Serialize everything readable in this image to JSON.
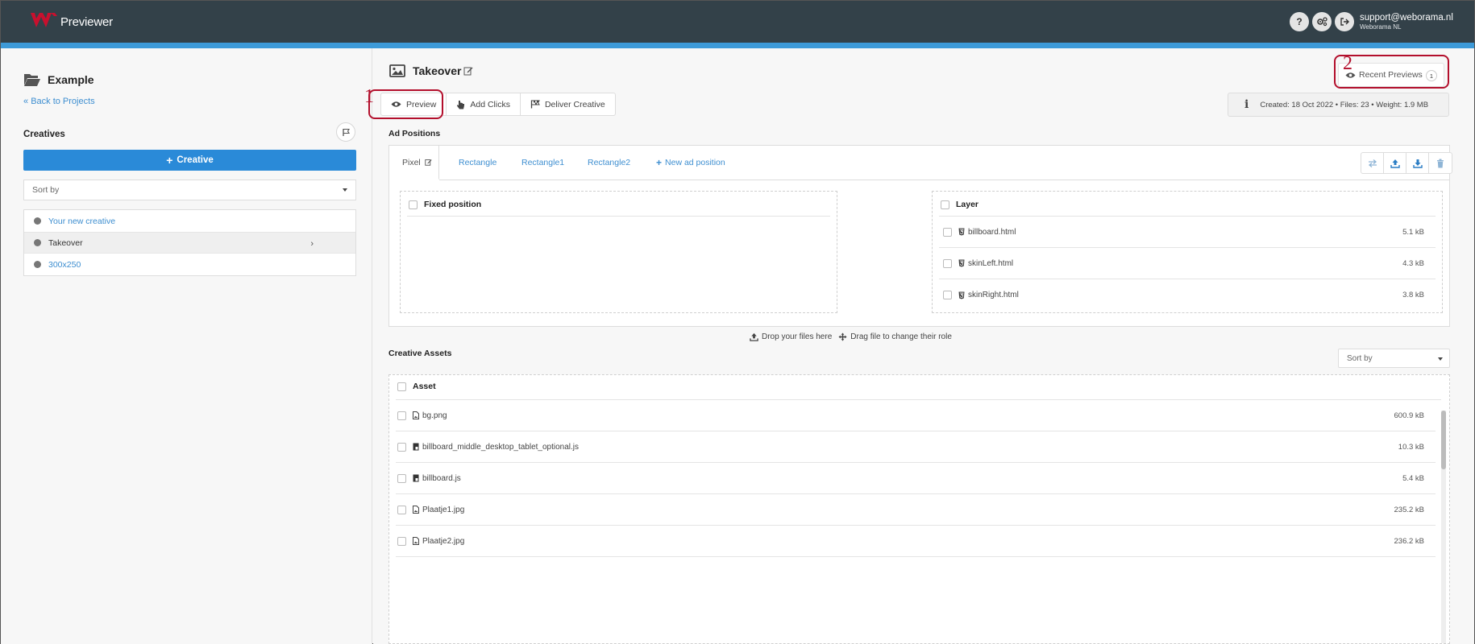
{
  "header": {
    "brand": "Previewer",
    "user_email": "support@weborama.nl",
    "user_org": "Weborama NL",
    "help_icon": "?"
  },
  "sidebar": {
    "project_title": "Example",
    "back_link": "Back to Projects",
    "creatives_label": "Creatives",
    "add_creative_label": "Creative",
    "sort_placeholder": "Sort by",
    "creatives": [
      {
        "name": "Your new creative",
        "active": false
      },
      {
        "name": "Takeover",
        "active": true
      },
      {
        "name": "300x250",
        "active": false
      }
    ]
  },
  "main": {
    "title": "Takeover",
    "recent_previews_label": "Recent Previews",
    "recent_previews_count": "1",
    "annotation_1": "1",
    "annotation_2": "2",
    "actions": {
      "preview": "Preview",
      "add_clicks": "Add Clicks",
      "deliver": "Deliver Creative"
    },
    "info": "Created: 18 Oct 2022 • Files: 23 • Weight: 1.9 MB",
    "ad_positions_label": "Ad Positions",
    "tabs": {
      "active": "Pixel",
      "others": [
        "Rectangle",
        "Rectangle1",
        "Rectangle2"
      ],
      "new": "New ad position"
    },
    "fixed_position_label": "Fixed position",
    "layer_label": "Layer",
    "layers": [
      {
        "name": "billboard.html",
        "size": "5.1 kB"
      },
      {
        "name": "skinLeft.html",
        "size": "4.3 kB"
      },
      {
        "name": "skinRight.html",
        "size": "3.8 kB"
      }
    ],
    "drop_hint": "Drop your files here",
    "drag_hint": "Drag file to change their role",
    "assets_label": "Creative Assets",
    "assets_sort_placeholder": "Sort by",
    "asset_col": "Asset",
    "assets": [
      {
        "name": "bg.png",
        "size": "600.9 kB",
        "icon": "image-file-icon"
      },
      {
        "name": "billboard_middle_desktop_tablet_optional.js",
        "size": "10.3 kB",
        "icon": "js-file-icon"
      },
      {
        "name": "billboard.js",
        "size": "5.4 kB",
        "icon": "js-file-icon"
      },
      {
        "name": "Plaatje1.jpg",
        "size": "235.2 kB",
        "icon": "image-file-icon"
      },
      {
        "name": "Plaatje2.jpg",
        "size": "236.2 kB",
        "icon": "image-file-icon"
      }
    ]
  },
  "colors": {
    "header_bg": "#334149",
    "accent_strip": "#3d9ad8",
    "primary_button": "#2a8ad8",
    "link": "#3d8ed0",
    "annotation": "#b30f2c",
    "logo": "#c8102e"
  }
}
